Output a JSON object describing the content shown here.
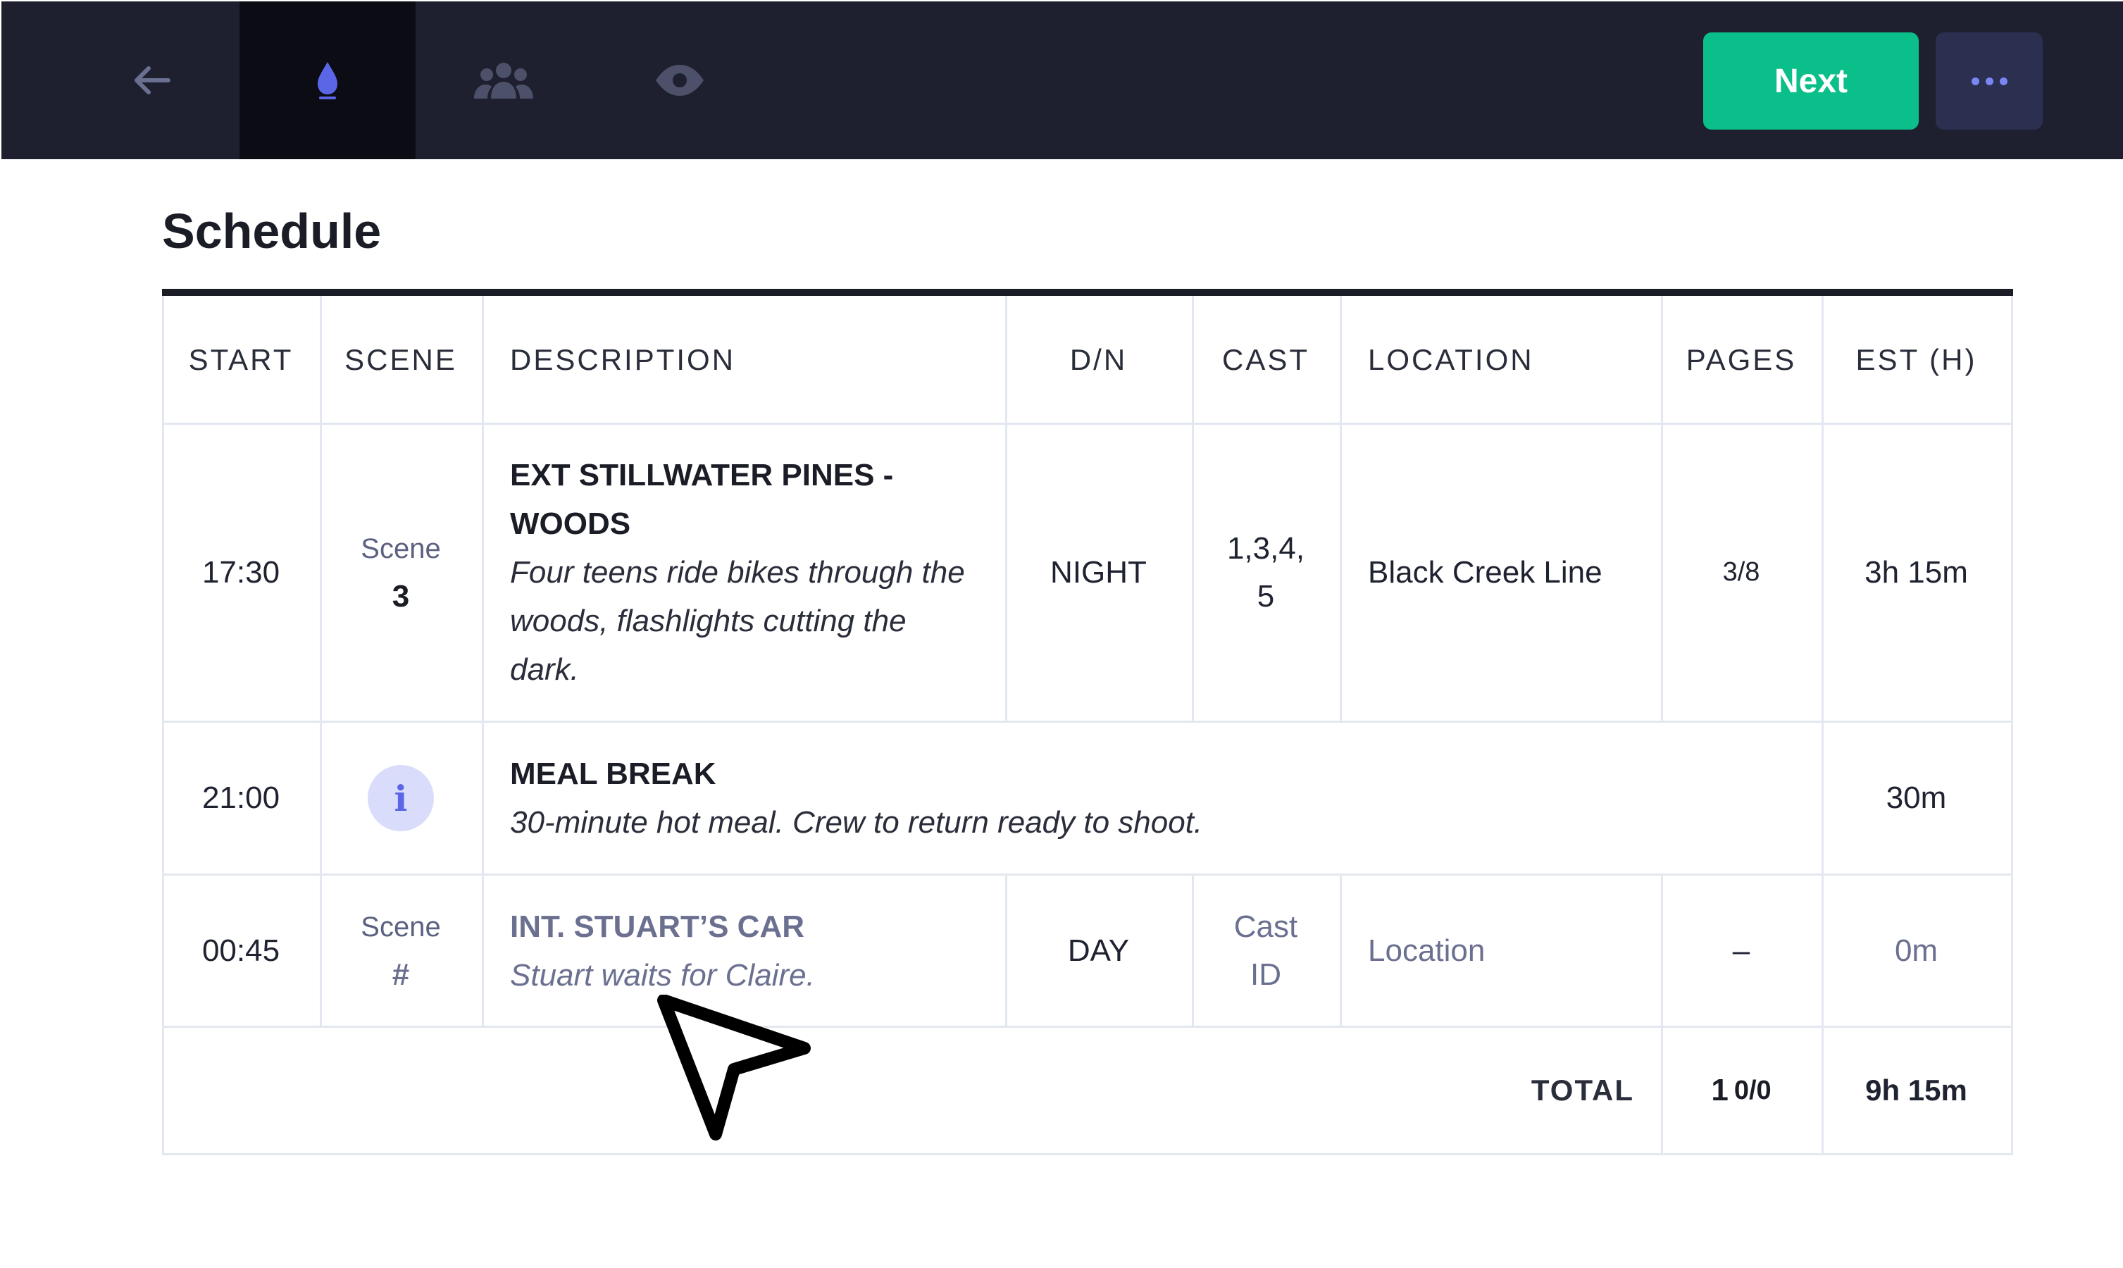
{
  "toolbar": {
    "icons": [
      "arrow-left-icon",
      "flame-icon",
      "people-icon",
      "eye-icon"
    ],
    "next_label": "Next",
    "more_icon": "ellipsis-icon",
    "colors": {
      "bar": "#1e2030",
      "next": "#0bbf8a",
      "accent": "#5b66e6"
    }
  },
  "page": {
    "title": "Schedule"
  },
  "table": {
    "headers": {
      "start": "START",
      "scene": "SCENE",
      "description": "DESCRIPTION",
      "dn": "D/N",
      "cast": "CAST",
      "location": "LOCATION",
      "pages": "PAGES",
      "est": "EST (H)"
    },
    "rows": [
      {
        "start": "17:30",
        "scene_label": "Scene",
        "scene_number": "3",
        "title_line1": "EXT STILLWATER PINES -",
        "title_line2": "WOODS",
        "desc_line1": "Four teens ride bikes through the",
        "desc_line2": "woods, flashlights cutting the",
        "desc_line3": "dark.",
        "dn": "NIGHT",
        "cast_line1": "1,3,4,",
        "cast_line2": "5",
        "location": "Black Creek Line",
        "pages": "3/8",
        "est": "3h 15m"
      },
      {
        "start": "21:00",
        "badge": "i",
        "title": "MEAL BREAK",
        "desc": "30-minute hot meal. Crew to return ready to shoot.",
        "est": "30m"
      },
      {
        "start": "00:45",
        "scene_label": "Scene",
        "scene_number": "#",
        "title": "INT. STUART’S CAR",
        "desc": "Stuart waits for Claire.",
        "dn": "DAY",
        "cast_line1": "Cast",
        "cast_line2": "ID",
        "location": "Location",
        "pages": "–",
        "est": "0m"
      }
    ],
    "total": {
      "label": "TOTAL",
      "pages_whole": "1",
      "pages_frac": "0/0",
      "est": "9h 15m"
    }
  }
}
